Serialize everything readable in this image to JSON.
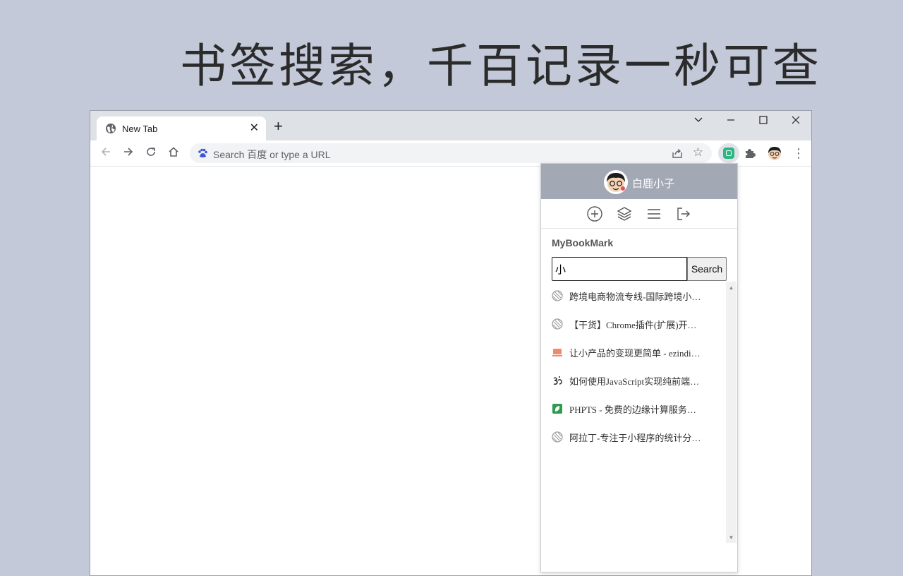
{
  "headline": "书签搜索，千百记录一秒可查",
  "browser": {
    "tab": {
      "title": "New Tab",
      "icon": "globe-icon"
    },
    "window_controls": [
      "tab-search",
      "minimize",
      "maximize",
      "close"
    ],
    "omnibox": {
      "placeholder": "Search 百度 or type a URL"
    }
  },
  "popup": {
    "user": {
      "name": "白鹿小子"
    },
    "actions": [
      "add-icon",
      "layers-icon",
      "menu-icon",
      "logout-icon"
    ],
    "title": "MyBookMark",
    "search": {
      "value": "小",
      "button_label": "Search"
    },
    "results": [
      {
        "label": "跨境电商物流专线-国际跨境小…",
        "favicon": "globe-icon"
      },
      {
        "label": "【干货】Chrome插件(扩展)开…",
        "favicon": "globe-icon"
      },
      {
        "label": "让小产品的变现更简单 - ezindi…",
        "favicon": "laptop-icon",
        "color": "#f08a6c"
      },
      {
        "label": "如何使用JavaScript实现纯前端…",
        "favicon": "om-icon"
      },
      {
        "label": "PHPTS - 免费的边缘计算服务…",
        "favicon": "leaf-icon",
        "color": "#2e9b4e"
      },
      {
        "label": "阿拉丁-专注于小程序的统计分…",
        "favicon": "globe-icon"
      }
    ]
  },
  "colors": {
    "background": "#c3c9d8",
    "popup_header": "#a3a8b5",
    "extension_accent": "#2db583"
  }
}
